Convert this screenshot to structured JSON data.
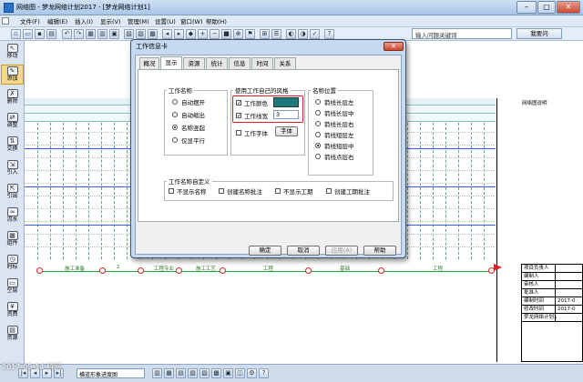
{
  "window": {
    "title": "网络图 - 梦龙网络计划2017 - [梦龙网络计划1]",
    "minimize": "–",
    "maximize": "□",
    "close": "✕"
  },
  "menu": [
    "文件(F)",
    "编辑(E)",
    "插入(I)",
    "显示(V)",
    "管理(M)",
    "设置(U)",
    "窗口(W)",
    "帮助(H)"
  ],
  "search": {
    "placeholder": "输入问题关键词",
    "button": "我要问"
  },
  "sidebar": [
    {
      "label": "移动",
      "icon": "pointer-icon"
    },
    {
      "label": "添加",
      "icon": "add-icon"
    },
    {
      "label": "删除",
      "icon": "delete-icon"
    },
    {
      "label": "调整",
      "icon": "adjust-icon"
    },
    {
      "label": "交换",
      "icon": "swap-icon"
    },
    {
      "label": "引入",
      "icon": "import-icon"
    },
    {
      "label": "引出",
      "icon": "export-icon"
    },
    {
      "label": "流水",
      "icon": "flow-icon"
    },
    {
      "label": "组件",
      "icon": "component-icon"
    },
    {
      "label": "时标",
      "icon": "timescale-icon"
    },
    {
      "label": "空层",
      "icon": "layer-icon"
    },
    {
      "label": "资费",
      "icon": "cost-icon"
    },
    {
      "label": "资源",
      "icon": "resource-icon"
    }
  ],
  "canvas": {
    "header_right": "网络图说明",
    "tasks": [
      "施工准备",
      "2",
      "工程专业",
      "施工工艺",
      "工程",
      "基础",
      "工程"
    ],
    "info_table": [
      {
        "k": "项目负责人",
        "v": ""
      },
      {
        "k": "编制人",
        "v": ""
      },
      {
        "k": "审核人",
        "v": ""
      },
      {
        "k": "批准人",
        "v": ""
      },
      {
        "k": "编制时间",
        "v": "2017-0"
      },
      {
        "k": "修改时间",
        "v": "2017-0"
      },
      {
        "k": "梦龙网络计划1",
        "v": ""
      }
    ]
  },
  "dialog": {
    "title": "工作信息卡",
    "close": "✕",
    "tabs": [
      "概况",
      "显示",
      "资源",
      "统计",
      "信息",
      "时间",
      "关系"
    ],
    "active_tab": "显示",
    "group_name": {
      "label": "工作名称",
      "options": [
        "自动摆开",
        "自动缩出",
        "名称竖起",
        "仅显平行"
      ],
      "selected": "名称竖起"
    },
    "group_style": {
      "label": "使用工作自己的风格",
      "color_label": "工作颜色",
      "width_label": "工作线宽",
      "width_value": "3",
      "font_label": "工作字体",
      "font_button": "字体",
      "color_value": "#1c7a7a"
    },
    "group_position": {
      "label": "名称位置",
      "options": [
        "箭线长层左",
        "箭线长层中",
        "箭线长层右",
        "箭线短层左",
        "箭线短层中",
        "箭线点层右"
      ],
      "selected": "箭线短层中"
    },
    "group_custom": {
      "label": "工作名称自定义",
      "options": [
        "不显示名称",
        "创建名称批注",
        "不显示工期",
        "创建工期批注"
      ]
    },
    "buttons": {
      "ok": "确定",
      "cancel": "取消",
      "apply": "应用(A)",
      "help": "帮助"
    }
  },
  "status": {
    "view_select": "横道形象进度图",
    "watermark": "2017-05-14 科网"
  }
}
